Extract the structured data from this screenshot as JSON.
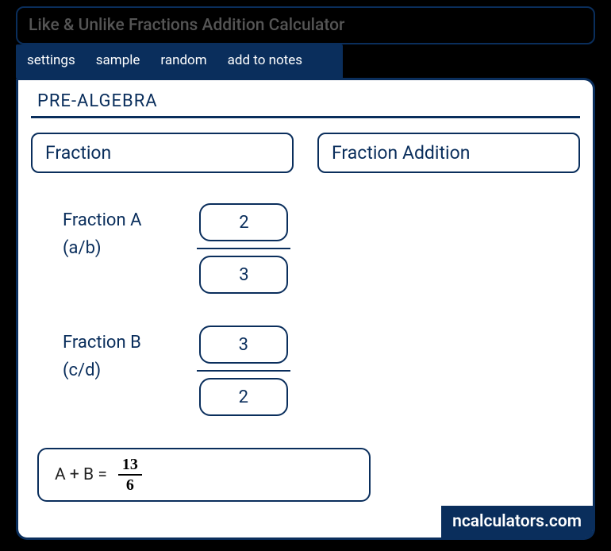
{
  "title": "Like & Unlike Fractions Addition Calculator",
  "menu": {
    "settings": "settings",
    "sample": "sample",
    "random": "random",
    "addnotes": "add to notes"
  },
  "section_title": "PRE-ALGEBRA",
  "dropdowns": {
    "fraction": "Fraction",
    "fraction_addition": "Fraction Addition"
  },
  "fractionA": {
    "label_line1": "Fraction A",
    "label_line2": "(a/b)",
    "numerator": "2",
    "denominator": "3"
  },
  "fractionB": {
    "label_line1": "Fraction B",
    "label_line2": "(c/d)",
    "numerator": "3",
    "denominator": "2"
  },
  "result": {
    "label": "A + B  = ",
    "numerator": "13",
    "denominator": "6"
  },
  "brand": "ncalculators.com"
}
